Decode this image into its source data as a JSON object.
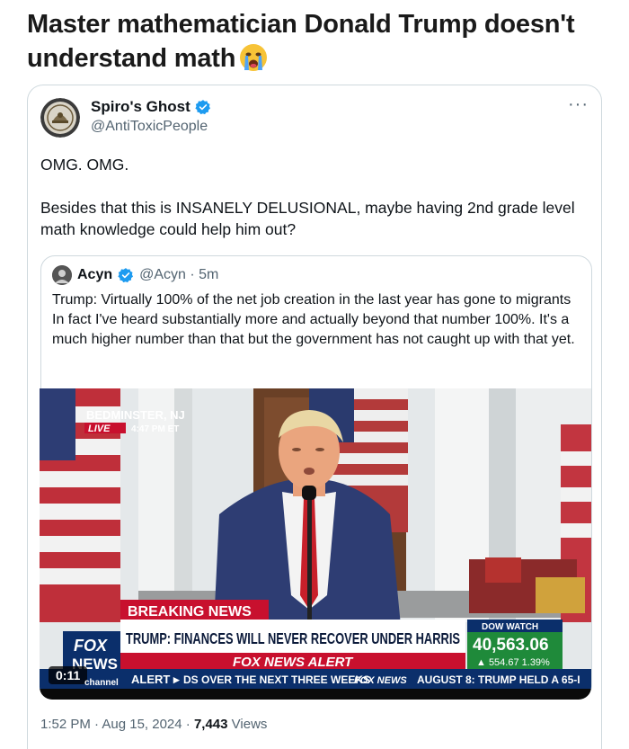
{
  "post": {
    "title": "Master mathematician Donald Trump doesn't understand math",
    "emoji_icon": "loudly-crying-face-icon"
  },
  "tweet": {
    "author_name": "Spiro's Ghost",
    "author_handle": "@AntiToxicPeople",
    "more_icon": "more-horizontal-icon",
    "more_glyph": "···",
    "line1": "OMG. OMG.",
    "line2": "Besides that this is INSANELY DELUSIONAL, maybe having 2nd grade level math knowledge could help him out?",
    "time": "1:52 PM · Aug 15, 2024 · ",
    "views_count": "7,443",
    "views_label": " Views"
  },
  "quote": {
    "author_name": "Acyn",
    "author_handle": "@Acyn · 5m",
    "text": "Trump: Virtually 100% of the net job creation in the last year has gone to migrants In fact I've heard substantially more and actually beyond that number 100%. It's a much higher number than that but the government has not caught up with that yet."
  },
  "video": {
    "location": "BEDMINSTER, NJ",
    "live": "LIVE",
    "live_time": "4:47 PM ET",
    "breaking": "BREAKING NEWS",
    "headline": "TRUMP: FINANCES WILL NEVER RECOVER UNDER HARRIS",
    "alert": "FOX NEWS ALERT",
    "dow_label": "DOW WATCH",
    "dow_value": "40,563.06",
    "dow_change": "▲ 554.67 1.39%",
    "logo_top": "FOX",
    "logo_bottom": "NEWS",
    "logo_channel": "channel",
    "duration": "0:11",
    "ticker_alert": "ALERT ▸",
    "ticker_text": "DS OVER THE NEXT THREE WEEKS",
    "ticker_brand": "FOX NEWS",
    "ticker_text2": "AUGUST 8: TRUMP HELD A 65-I",
    "colors": {
      "fox_red": "#c8102e",
      "fox_navy": "#0b2f6b",
      "dow_green": "#1f8a3a"
    }
  }
}
